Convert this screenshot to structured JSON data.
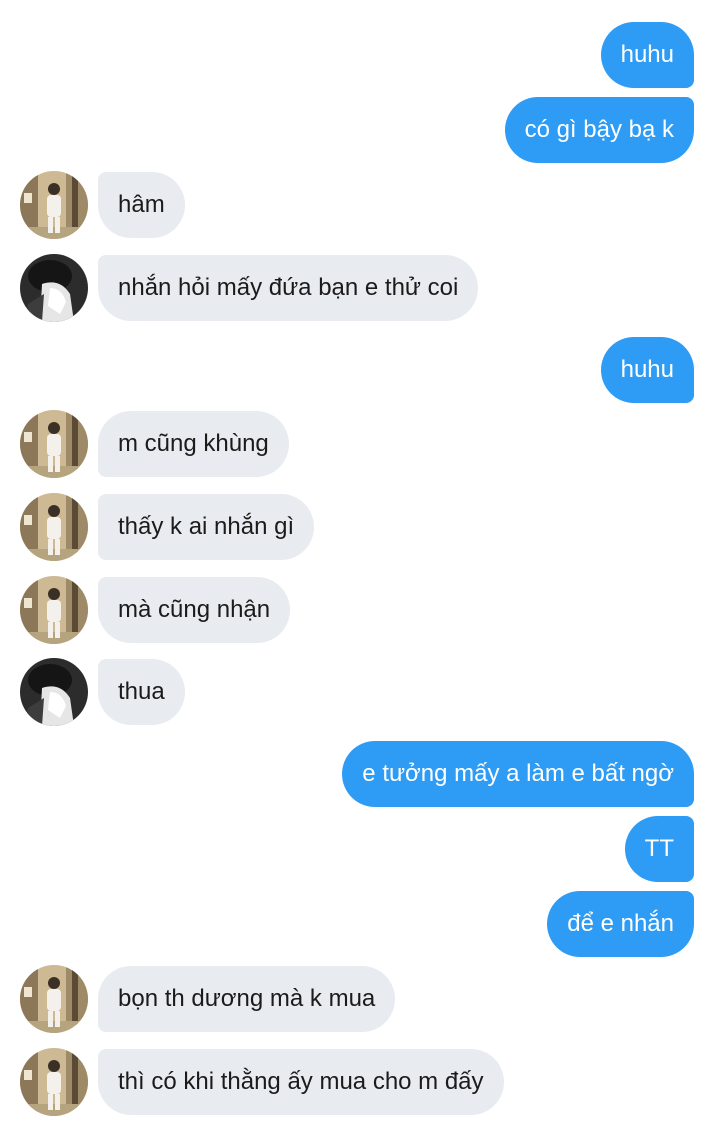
{
  "colors": {
    "outgoing_bubble": "#2e9cf5",
    "outgoing_text": "#ffffff",
    "incoming_bubble": "#e8ebf0",
    "incoming_text": "#1b1b1b"
  },
  "messages": [
    {
      "side": "out",
      "text": "huhu"
    },
    {
      "side": "out",
      "text": "có gì bậy bạ k"
    },
    {
      "side": "in",
      "avatar": "hallway-person-avatar-icon",
      "text": "hâm"
    },
    {
      "side": "in",
      "avatar": "dark-face-avatar-icon",
      "text": "nhắn hỏi mấy đứa bạn e thử coi"
    },
    {
      "side": "out",
      "text": "huhu"
    },
    {
      "side": "in",
      "avatar": "hallway-person-avatar-icon",
      "text": "m cũng khùng"
    },
    {
      "side": "in",
      "avatar": "hallway-person-avatar-icon",
      "text": "thấy k ai nhắn gì"
    },
    {
      "side": "in",
      "avatar": "hallway-person-avatar-icon",
      "text": "mà cũng nhận"
    },
    {
      "side": "in",
      "avatar": "dark-face-avatar-icon",
      "text": "thua"
    },
    {
      "side": "out",
      "text": "e tưởng mấy a làm e bất ngờ"
    },
    {
      "side": "out",
      "text": "TT"
    },
    {
      "side": "out",
      "text": "để e nhắn"
    },
    {
      "side": "in",
      "avatar": "hallway-person-avatar-icon",
      "text": "bọn th dương mà k mua"
    },
    {
      "side": "in",
      "avatar": "hallway-person-avatar-icon",
      "text": "thì có khi thằng ấy mua cho m đấy"
    }
  ]
}
